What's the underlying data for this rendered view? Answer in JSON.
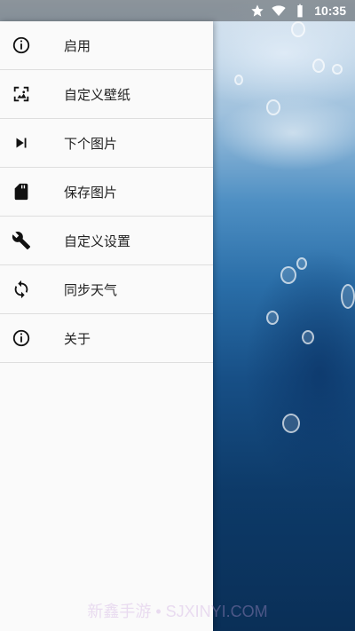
{
  "statusbar": {
    "time": "10:35"
  },
  "drawer": {
    "items": [
      {
        "label": "启用",
        "icon": "info-icon"
      },
      {
        "label": "自定义壁纸",
        "icon": "wallpaper-icon"
      },
      {
        "label": "下个图片",
        "icon": "skip-next-icon"
      },
      {
        "label": "保存图片",
        "icon": "sd-card-icon"
      },
      {
        "label": "自定义设置",
        "icon": "wrench-icon"
      },
      {
        "label": "同步天气",
        "icon": "sync-icon"
      },
      {
        "label": "关于",
        "icon": "info-icon"
      }
    ]
  },
  "watermark": "新鑫手游 • SJXINYI.COM",
  "colors": {
    "drawer_bg": "#fafafa",
    "divider": "#dedede",
    "icon": "#111111"
  }
}
